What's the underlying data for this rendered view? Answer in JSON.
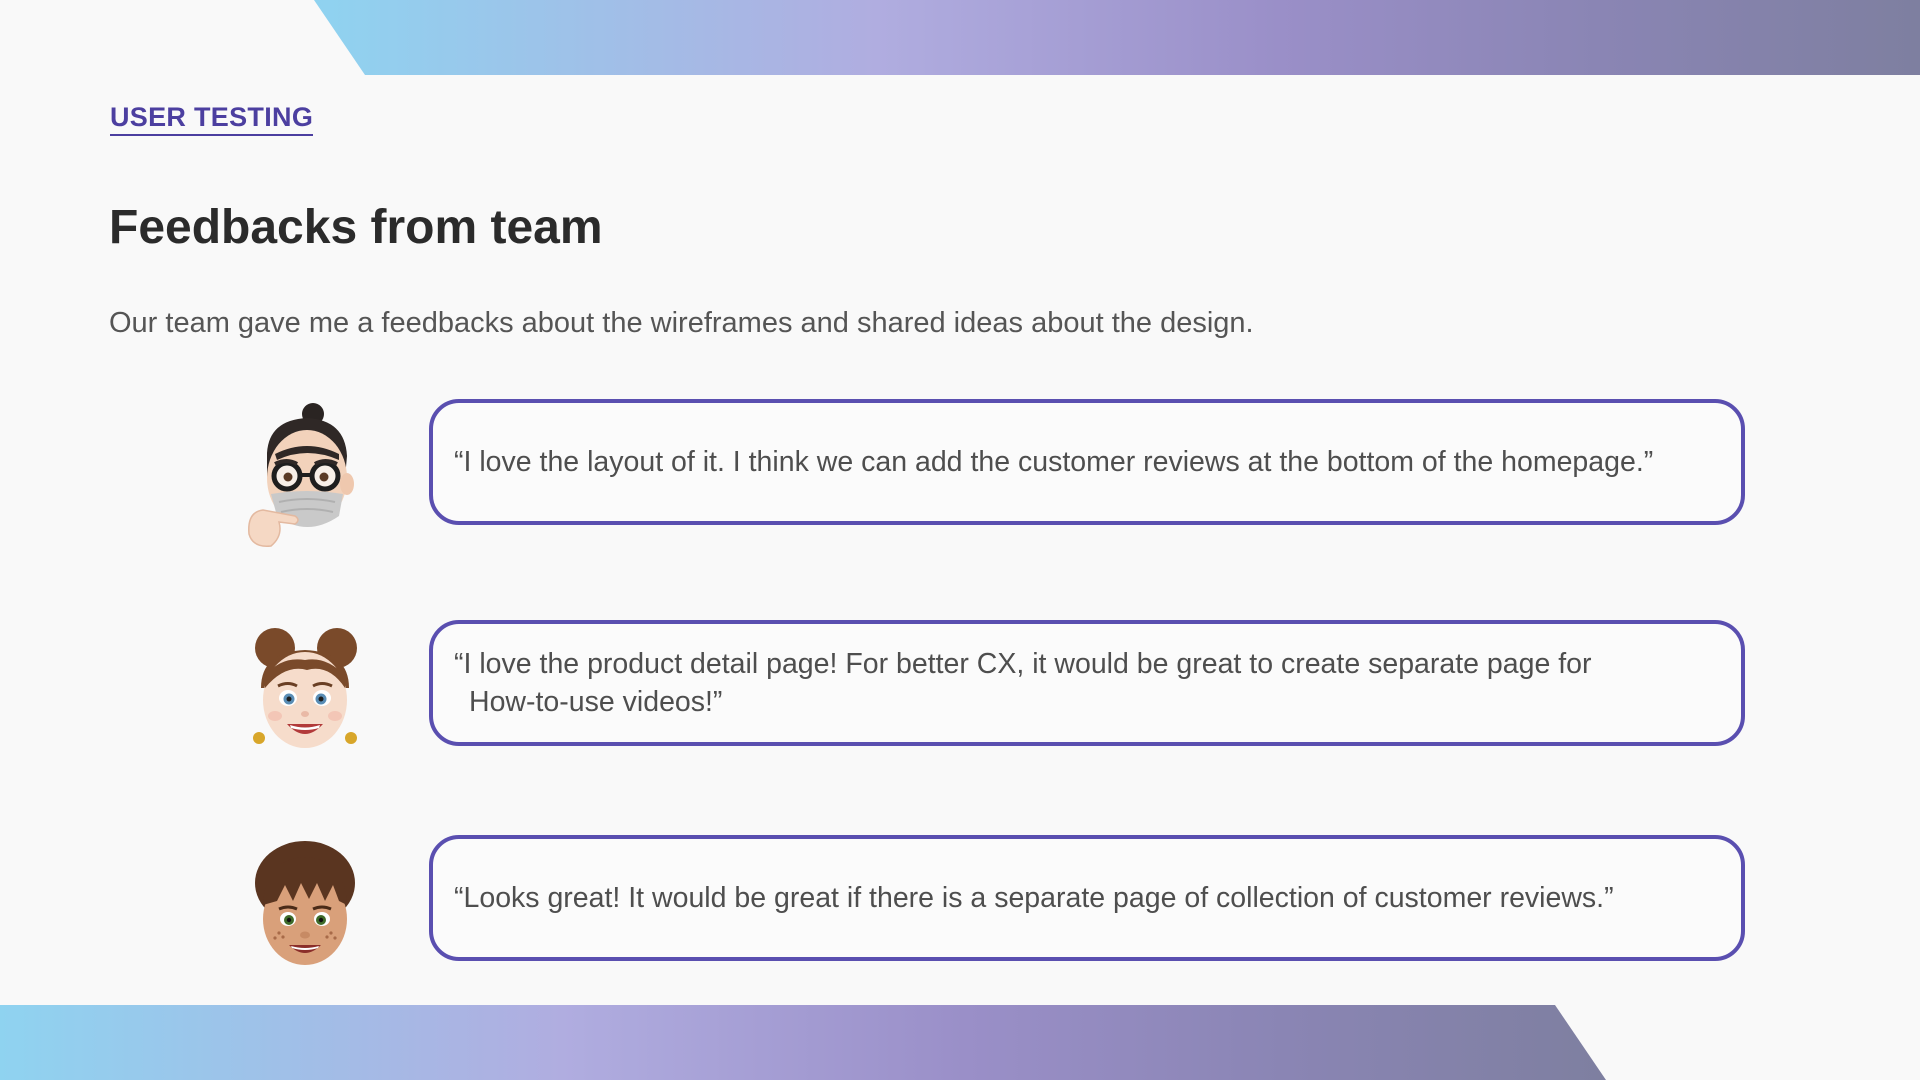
{
  "header": {
    "eyebrow": "USER TESTING",
    "title": "Feedbacks from team",
    "subtitle": "Our team gave me a feedbacks about the wireframes and shared ideas about the design."
  },
  "colors": {
    "accent": "#4c3fa0",
    "bubble_border": "#5a4fb0",
    "gradient_start": "#8fd3f0",
    "gradient_mid": "#b0ade0",
    "gradient_end": "#7e7fa0"
  },
  "feedbacks": [
    {
      "avatar_icon": "man-with-glasses-and-mask-avatar",
      "quote": "“I love the layout of it. I think we can add the customer reviews at the bottom of the homepage.”"
    },
    {
      "avatar_icon": "woman-with-hair-buns-avatar",
      "quote_line1": "“I love the product detail page! For better CX, it would be great to create separate page for",
      "quote_line2": "How-to-use videos!”"
    },
    {
      "avatar_icon": "boy-with-bangs-avatar",
      "quote": "“Looks great! It would be great if there is a separate page of collection of customer reviews.”"
    }
  ]
}
